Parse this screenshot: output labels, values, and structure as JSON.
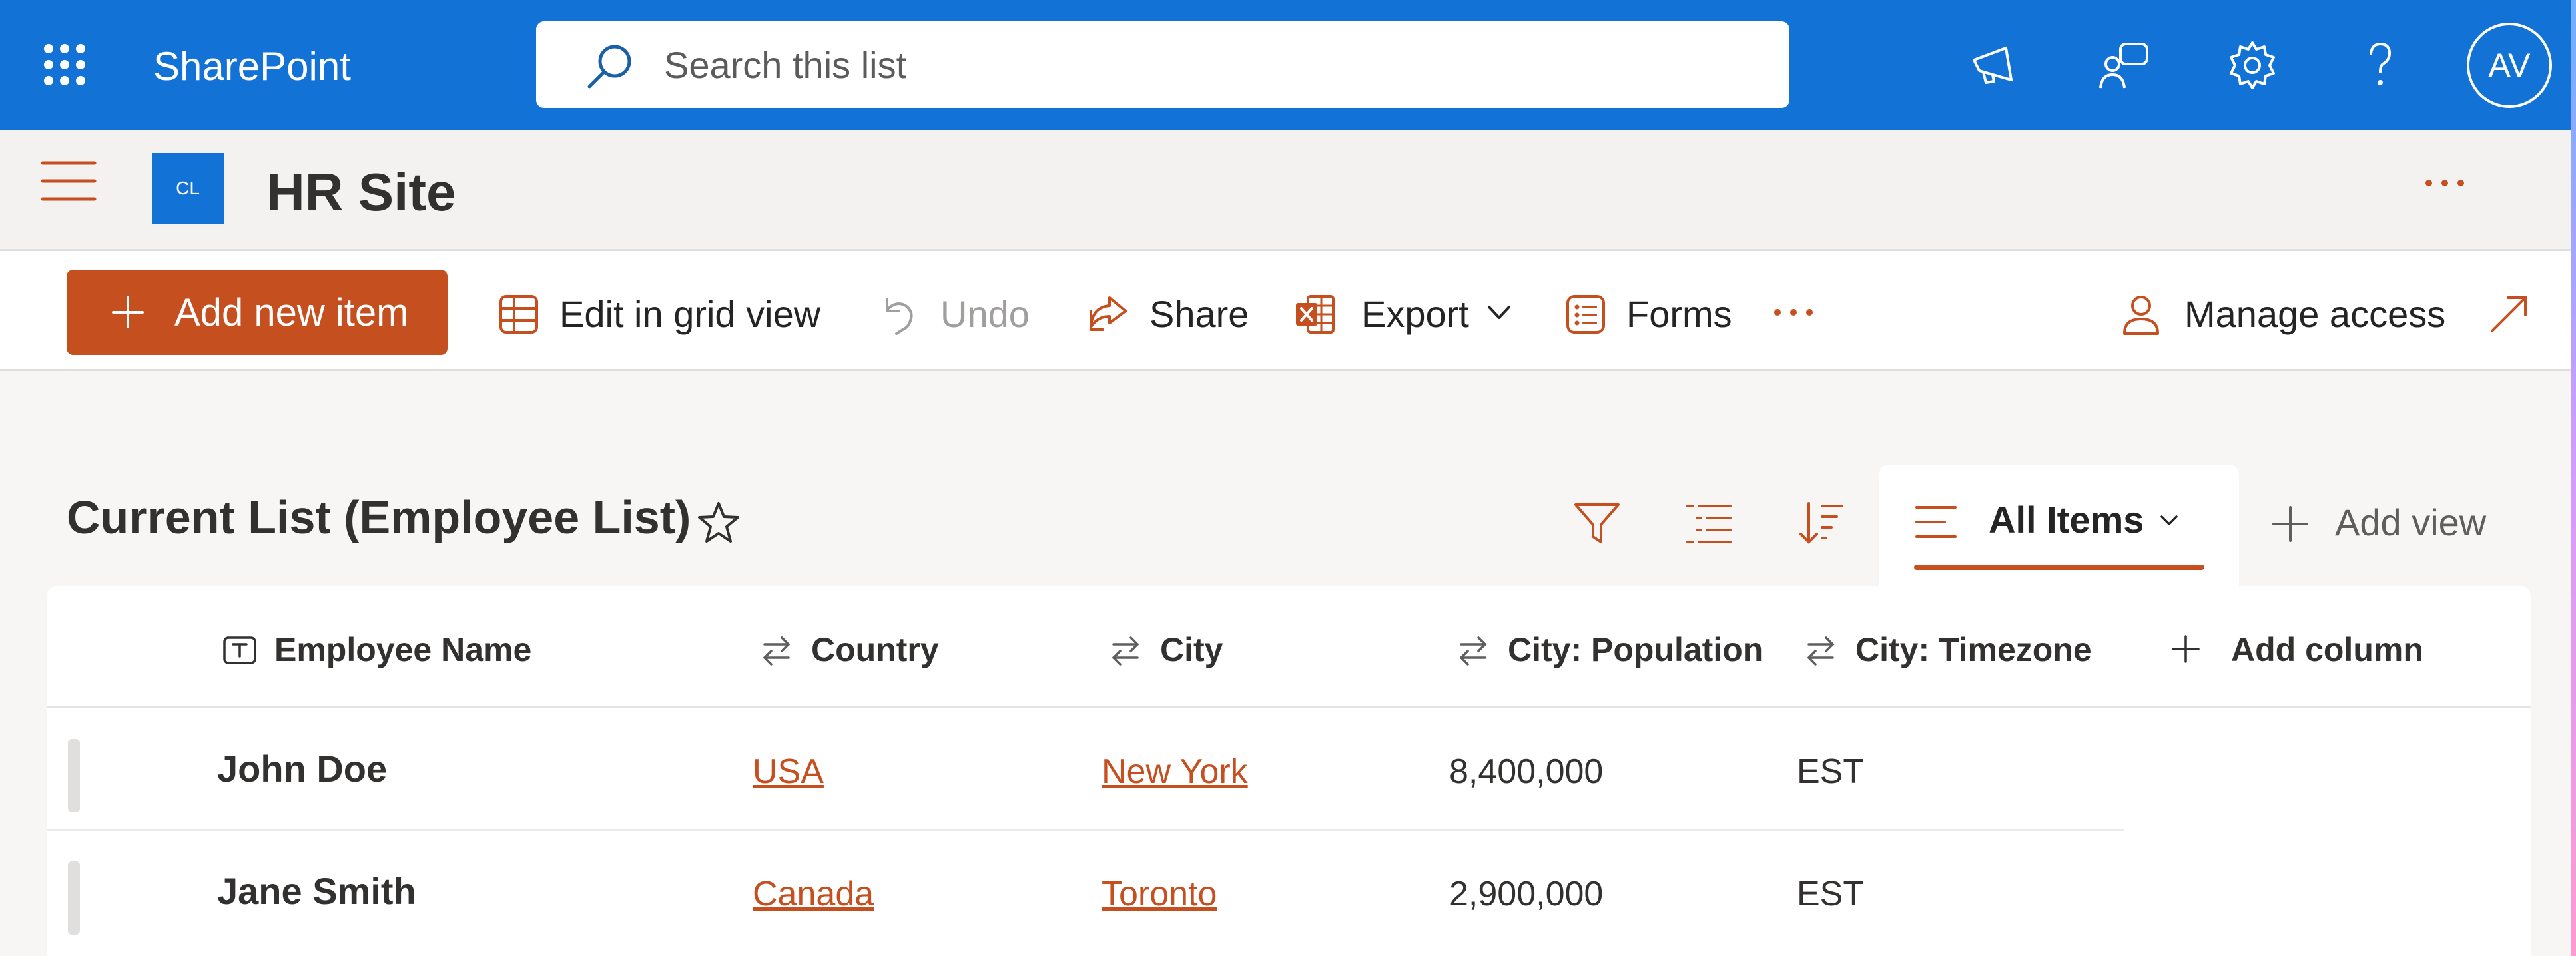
{
  "suite": {
    "app_name": "SharePoint",
    "search_placeholder": "Search this list",
    "avatar_initials": "AV",
    "icons": [
      "app-launcher-icon",
      "megaphone-icon",
      "chat-icon",
      "gear-icon",
      "help-icon"
    ]
  },
  "site": {
    "logo_text": "CL",
    "title": "HR Site"
  },
  "commands": {
    "add_new_item": "Add new item",
    "edit_grid": "Edit in grid view",
    "undo": "Undo",
    "share": "Share",
    "export": "Export",
    "forms": "Forms",
    "manage_access": "Manage access"
  },
  "list": {
    "title": "Current List (Employee List)",
    "view_name": "All Items",
    "add_view": "Add view",
    "columns": [
      {
        "label": "Employee Name",
        "icon": "text-field-icon"
      },
      {
        "label": "Country",
        "icon": "lookup-icon"
      },
      {
        "label": "City",
        "icon": "lookup-icon"
      },
      {
        "label": "City: Population",
        "icon": "lookup-icon"
      },
      {
        "label": "City: Timezone",
        "icon": "lookup-icon"
      }
    ],
    "add_column": "Add column",
    "rows": [
      {
        "name": "John Doe",
        "country": "USA",
        "city": "New York",
        "population": "8,400,000",
        "timezone": "EST"
      },
      {
        "name": "Jane Smith",
        "country": "Canada",
        "city": "Toronto",
        "population": "2,900,000",
        "timezone": "EST"
      }
    ]
  },
  "colors": {
    "suite_blue": "#1272d6",
    "accent_orange": "#c64f1f"
  }
}
